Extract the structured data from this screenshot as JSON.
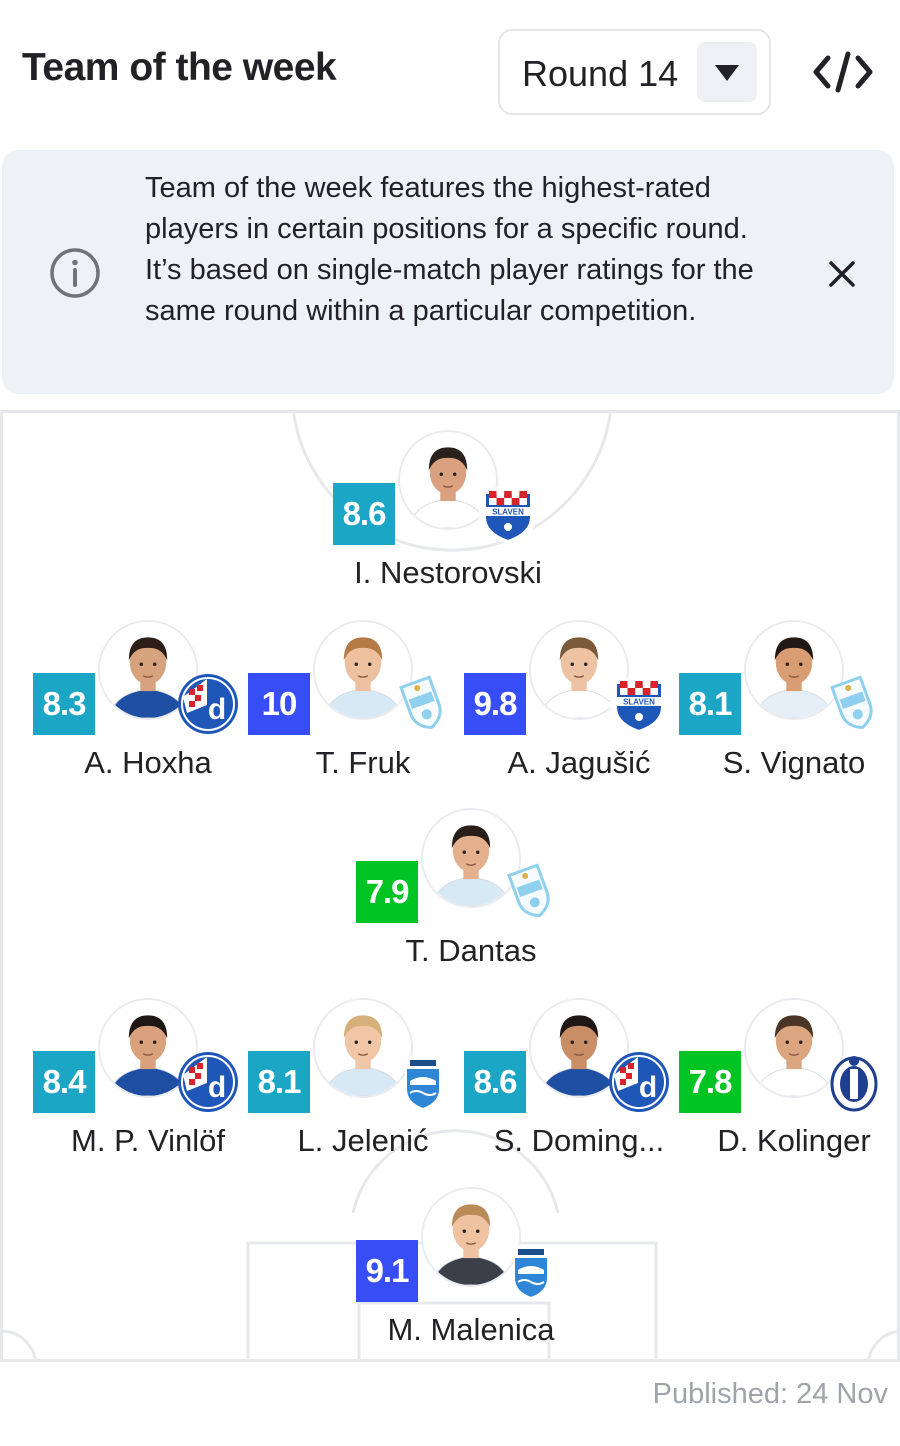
{
  "header": {
    "title": "Team of the week",
    "round_label": "Round 14"
  },
  "info": {
    "text": "Team of the week features the highest-rated players in certain positions for a specific round. It’s based on single-match player ratings for the same round within a particular competition."
  },
  "colors": {
    "rating_teal": "#1aa6c4",
    "rating_blue": "#374df5",
    "rating_green": "#00c424",
    "text_primary": "#222226",
    "muted": "#a0a4aa",
    "info_bg": "#eef1f5"
  },
  "players": [
    {
      "name": "I. Nestorovski",
      "rating": "8.6",
      "rating_color": "#1aa6c4",
      "club_icon": "slaven-crest-icon",
      "skin": "#d9a17f",
      "hair": "#2a211c",
      "shirt": "#ffffff"
    },
    {
      "name": "A. Hoxha",
      "rating": "8.3",
      "rating_color": "#1aa6c4",
      "club_icon": "dinamo-crest-icon",
      "skin": "#d7a27e",
      "hair": "#2b1f18",
      "shirt": "#1f4fa3"
    },
    {
      "name": "T. Fruk",
      "rating": "10",
      "rating_color": "#374df5",
      "club_icon": "rijeka-crest-icon",
      "skin": "#edc0a0",
      "hair": "#b57a45",
      "shirt": "#d8e9f6"
    },
    {
      "name": "A. Jagušić",
      "rating": "9.8",
      "rating_color": "#374df5",
      "club_icon": "slaven-crest-icon",
      "skin": "#eec3a4",
      "hair": "#7b5a3c",
      "shirt": "#ffffff"
    },
    {
      "name": "S. Vignato",
      "rating": "8.1",
      "rating_color": "#1aa6c4",
      "club_icon": "rijeka-crest-icon",
      "skin": "#d89d73",
      "hair": "#221a15",
      "shirt": "#e6eff7"
    },
    {
      "name": "T. Dantas",
      "rating": "7.9",
      "rating_color": "#00c424",
      "club_icon": "rijeka-crest-icon",
      "skin": "#e4b08d",
      "hair": "#2a1f18",
      "shirt": "#d8e9f6"
    },
    {
      "name": "M. P. Vinlöf",
      "rating": "8.4",
      "rating_color": "#1aa6c4",
      "club_icon": "dinamo-crest-icon",
      "skin": "#d9a27c",
      "hair": "#1e1612",
      "shirt": "#1f4fa3"
    },
    {
      "name": "L. Jelenić",
      "rating": "8.1",
      "rating_color": "#1aa6c4",
      "club_icon": "osijek-crest-icon",
      "skin": "#f1c6a6",
      "hair": "#d6b07a",
      "shirt": "#d8e9f6"
    },
    {
      "name": "S. Doming...",
      "rating": "8.6",
      "rating_color": "#1aa6c4",
      "club_icon": "dinamo-crest-icon",
      "skin": "#c98e66",
      "hair": "#1e1612",
      "shirt": "#1f4fa3"
    },
    {
      "name": "D. Kolinger",
      "rating": "7.8",
      "rating_color": "#00c424",
      "club_icon": "lokomotiva-crest-icon",
      "skin": "#dba580",
      "hair": "#4a3526",
      "shirt": "#ffffff"
    },
    {
      "name": "M. Malenica",
      "rating": "9.1",
      "rating_color": "#374df5",
      "club_icon": "osijek-crest-icon",
      "skin": "#efc2a2",
      "hair": "#b88b58",
      "shirt": "#3c3f4a"
    }
  ],
  "footer": {
    "published": "Published: 24 Nov"
  }
}
